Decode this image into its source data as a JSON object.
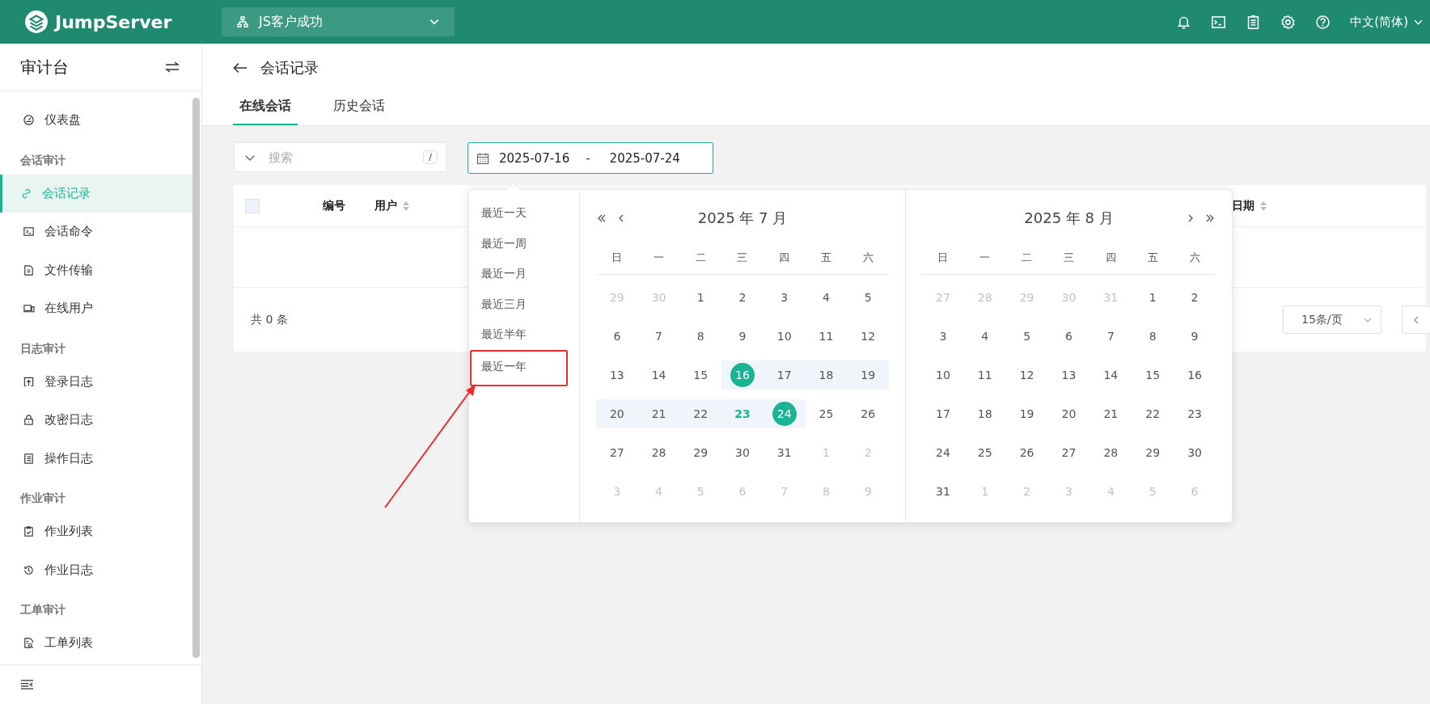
{
  "topbar": {
    "brand": "JumpServer",
    "project": "JS客户成功",
    "language": "中文(简体)"
  },
  "sidebar": {
    "title": "审计台",
    "items": [
      {
        "kind": "item",
        "label": "仪表盘",
        "selected": false
      },
      {
        "kind": "group",
        "label": "会话审计"
      },
      {
        "kind": "item",
        "label": "会话记录",
        "selected": true
      },
      {
        "kind": "item",
        "label": "会话命令",
        "selected": false
      },
      {
        "kind": "item",
        "label": "文件传输",
        "selected": false
      },
      {
        "kind": "item",
        "label": "在线用户",
        "selected": false
      },
      {
        "kind": "group",
        "label": "日志审计"
      },
      {
        "kind": "item",
        "label": "登录日志",
        "selected": false
      },
      {
        "kind": "item",
        "label": "改密日志",
        "selected": false
      },
      {
        "kind": "item",
        "label": "操作日志",
        "selected": false
      },
      {
        "kind": "group",
        "label": "作业审计"
      },
      {
        "kind": "item",
        "label": "作业列表",
        "selected": false
      },
      {
        "kind": "item",
        "label": "作业日志",
        "selected": false
      },
      {
        "kind": "group",
        "label": "工单审计"
      },
      {
        "kind": "item",
        "label": "工单列表",
        "selected": false
      }
    ]
  },
  "page": {
    "title": "会话记录",
    "tabs": [
      {
        "label": "在线会话",
        "selected": true
      },
      {
        "label": "历史会话",
        "selected": false
      }
    ]
  },
  "filters": {
    "search": {
      "placeholder": "搜索",
      "shortcut": "/"
    },
    "date_range": {
      "start": "2025-07-16",
      "separator": "-",
      "end": "2025-07-24"
    }
  },
  "table": {
    "select_all": {
      "checked": false
    },
    "columns": [
      {
        "label": "编号",
        "sortable": false
      },
      {
        "label": "用户",
        "sortable": true
      },
      {
        "label": "日期",
        "sortable": true
      }
    ],
    "total": "共 0 条",
    "page_size": "15条/页"
  },
  "date_picker": {
    "shortcuts": [
      {
        "label": "最近一天",
        "annotated": false
      },
      {
        "label": "最近一周",
        "annotated": false
      },
      {
        "label": "最近一月",
        "annotated": false
      },
      {
        "label": "最近三月",
        "annotated": false
      },
      {
        "label": "最近半年",
        "annotated": false
      },
      {
        "label": "最近一年",
        "annotated": true
      }
    ],
    "months": [
      {
        "title": "2025 年 7 月",
        "weekdays": [
          "日",
          "一",
          "二",
          "三",
          "四",
          "五",
          "六"
        ],
        "days": [
          {
            "d": "29",
            "kind": "other",
            "selected": false,
            "in_range": false
          },
          {
            "d": "30",
            "kind": "other",
            "selected": false,
            "in_range": false
          },
          {
            "d": "1",
            "kind": "current",
            "selected": false,
            "in_range": false
          },
          {
            "d": "2",
            "kind": "current",
            "selected": false,
            "in_range": false
          },
          {
            "d": "3",
            "kind": "current",
            "selected": false,
            "in_range": false
          },
          {
            "d": "4",
            "kind": "current",
            "selected": false,
            "in_range": false
          },
          {
            "d": "5",
            "kind": "current",
            "selected": false,
            "in_range": false
          },
          {
            "d": "6",
            "kind": "current",
            "selected": false,
            "in_range": false
          },
          {
            "d": "7",
            "kind": "current",
            "selected": false,
            "in_range": false
          },
          {
            "d": "8",
            "kind": "current",
            "selected": false,
            "in_range": false
          },
          {
            "d": "9",
            "kind": "current",
            "selected": false,
            "in_range": false
          },
          {
            "d": "10",
            "kind": "current",
            "selected": false,
            "in_range": false
          },
          {
            "d": "11",
            "kind": "current",
            "selected": false,
            "in_range": false
          },
          {
            "d": "12",
            "kind": "current",
            "selected": false,
            "in_range": false
          },
          {
            "d": "13",
            "kind": "current",
            "selected": false,
            "in_range": false
          },
          {
            "d": "14",
            "kind": "current",
            "selected": false,
            "in_range": false
          },
          {
            "d": "15",
            "kind": "current",
            "selected": false,
            "in_range": false
          },
          {
            "d": "16",
            "kind": "current",
            "selected": true,
            "in_range": true
          },
          {
            "d": "17",
            "kind": "current",
            "selected": false,
            "in_range": true
          },
          {
            "d": "18",
            "kind": "current",
            "selected": false,
            "in_range": true
          },
          {
            "d": "19",
            "kind": "current",
            "selected": false,
            "in_range": true
          },
          {
            "d": "20",
            "kind": "current",
            "selected": false,
            "in_range": true
          },
          {
            "d": "21",
            "kind": "current",
            "selected": false,
            "in_range": true
          },
          {
            "d": "22",
            "kind": "current",
            "selected": false,
            "in_range": true
          },
          {
            "d": "23",
            "kind": "today",
            "selected": false,
            "in_range": true
          },
          {
            "d": "24",
            "kind": "current",
            "selected": true,
            "in_range": true
          },
          {
            "d": "25",
            "kind": "current",
            "selected": false,
            "in_range": false
          },
          {
            "d": "26",
            "kind": "current",
            "selected": false,
            "in_range": false
          },
          {
            "d": "27",
            "kind": "current",
            "selected": false,
            "in_range": false
          },
          {
            "d": "28",
            "kind": "current",
            "selected": false,
            "in_range": false
          },
          {
            "d": "29",
            "kind": "current",
            "selected": false,
            "in_range": false
          },
          {
            "d": "30",
            "kind": "current",
            "selected": false,
            "in_range": false
          },
          {
            "d": "31",
            "kind": "current",
            "selected": false,
            "in_range": false
          },
          {
            "d": "1",
            "kind": "other",
            "selected": false,
            "in_range": false
          },
          {
            "d": "2",
            "kind": "other",
            "selected": false,
            "in_range": false
          },
          {
            "d": "3",
            "kind": "other",
            "selected": false,
            "in_range": false
          },
          {
            "d": "4",
            "kind": "other",
            "selected": false,
            "in_range": false
          },
          {
            "d": "5",
            "kind": "other",
            "selected": false,
            "in_range": false
          },
          {
            "d": "6",
            "kind": "other",
            "selected": false,
            "in_range": false
          },
          {
            "d": "7",
            "kind": "other",
            "selected": false,
            "in_range": false
          },
          {
            "d": "8",
            "kind": "other",
            "selected": false,
            "in_range": false
          },
          {
            "d": "9",
            "kind": "other",
            "selected": false,
            "in_range": false
          }
        ]
      },
      {
        "title": "2025 年 8 月",
        "weekdays": [
          "日",
          "一",
          "二",
          "三",
          "四",
          "五",
          "六"
        ],
        "days": [
          {
            "d": "27",
            "kind": "other",
            "selected": false,
            "in_range": false
          },
          {
            "d": "28",
            "kind": "other",
            "selected": false,
            "in_range": false
          },
          {
            "d": "29",
            "kind": "other",
            "selected": false,
            "in_range": false
          },
          {
            "d": "30",
            "kind": "other",
            "selected": false,
            "in_range": false
          },
          {
            "d": "31",
            "kind": "other",
            "selected": false,
            "in_range": false
          },
          {
            "d": "1",
            "kind": "current",
            "selected": false,
            "in_range": false
          },
          {
            "d": "2",
            "kind": "current",
            "selected": false,
            "in_range": false
          },
          {
            "d": "3",
            "kind": "current",
            "selected": false,
            "in_range": false
          },
          {
            "d": "4",
            "kind": "current",
            "selected": false,
            "in_range": false
          },
          {
            "d": "5",
            "kind": "current",
            "selected": false,
            "in_range": false
          },
          {
            "d": "6",
            "kind": "current",
            "selected": false,
            "in_range": false
          },
          {
            "d": "7",
            "kind": "current",
            "selected": false,
            "in_range": false
          },
          {
            "d": "8",
            "kind": "current",
            "selected": false,
            "in_range": false
          },
          {
            "d": "9",
            "kind": "current",
            "selected": false,
            "in_range": false
          },
          {
            "d": "10",
            "kind": "current",
            "selected": false,
            "in_range": false
          },
          {
            "d": "11",
            "kind": "current",
            "selected": false,
            "in_range": false
          },
          {
            "d": "12",
            "kind": "current",
            "selected": false,
            "in_range": false
          },
          {
            "d": "13",
            "kind": "current",
            "selected": false,
            "in_range": false
          },
          {
            "d": "14",
            "kind": "current",
            "selected": false,
            "in_range": false
          },
          {
            "d": "15",
            "kind": "current",
            "selected": false,
            "in_range": false
          },
          {
            "d": "16",
            "kind": "current",
            "selected": false,
            "in_range": false
          },
          {
            "d": "17",
            "kind": "current",
            "selected": false,
            "in_range": false
          },
          {
            "d": "18",
            "kind": "current",
            "selected": false,
            "in_range": false
          },
          {
            "d": "19",
            "kind": "current",
            "selected": false,
            "in_range": false
          },
          {
            "d": "20",
            "kind": "current",
            "selected": false,
            "in_range": false
          },
          {
            "d": "21",
            "kind": "current",
            "selected": false,
            "in_range": false
          },
          {
            "d": "22",
            "kind": "current",
            "selected": false,
            "in_range": false
          },
          {
            "d": "23",
            "kind": "current",
            "selected": false,
            "in_range": false
          },
          {
            "d": "24",
            "kind": "current",
            "selected": false,
            "in_range": false
          },
          {
            "d": "25",
            "kind": "current",
            "selected": false,
            "in_range": false
          },
          {
            "d": "26",
            "kind": "current",
            "selected": false,
            "in_range": false
          },
          {
            "d": "27",
            "kind": "current",
            "selected": false,
            "in_range": false
          },
          {
            "d": "28",
            "kind": "current",
            "selected": false,
            "in_range": false
          },
          {
            "d": "29",
            "kind": "current",
            "selected": false,
            "in_range": false
          },
          {
            "d": "30",
            "kind": "current",
            "selected": false,
            "in_range": false
          },
          {
            "d": "31",
            "kind": "current",
            "selected": false,
            "in_range": false
          },
          {
            "d": "1",
            "kind": "other",
            "selected": false,
            "in_range": false
          },
          {
            "d": "2",
            "kind": "other",
            "selected": false,
            "in_range": false
          },
          {
            "d": "3",
            "kind": "other",
            "selected": false,
            "in_range": false
          },
          {
            "d": "4",
            "kind": "other",
            "selected": false,
            "in_range": false
          },
          {
            "d": "5",
            "kind": "other",
            "selected": false,
            "in_range": false
          },
          {
            "d": "6",
            "kind": "other",
            "selected": false,
            "in_range": false
          }
        ]
      }
    ]
  }
}
